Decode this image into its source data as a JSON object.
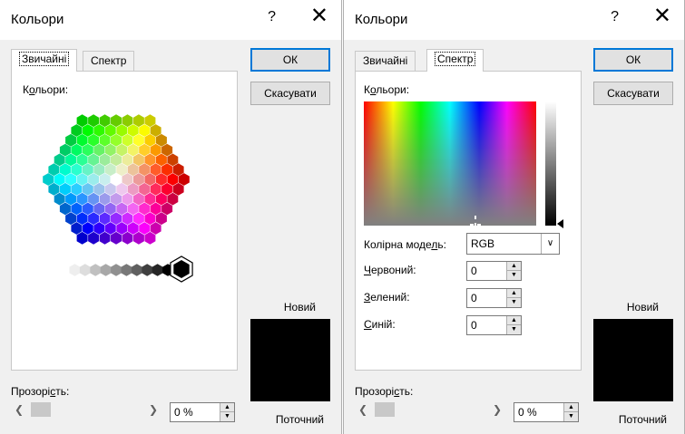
{
  "dialog": {
    "title": "Кольори",
    "help": "?",
    "close": "✕",
    "tabs": [
      "Звичайні",
      "Спектр"
    ],
    "ok": "ОК",
    "cancel": "Скасувати",
    "new_label": "Новий",
    "current_label": "Поточний",
    "current_color": "#000000",
    "transparency_prefix": "Прозорі",
    "transparency_mnemonic": "с",
    "transparency_suffix": "ть:",
    "transparency_value": "0 %"
  },
  "standard": {
    "colors_prefix": "К",
    "colors_mnemonic": "о",
    "colors_suffix": "льори:"
  },
  "spectrum": {
    "colors_prefix": "К",
    "colors_mnemonic": "о",
    "colors_suffix": "льори:",
    "model_prefix": "Колірна моде",
    "model_mnemonic": "л",
    "model_suffix": "ь:",
    "model_value": "RGB",
    "red_prefix": "",
    "red_mnemonic": "Ч",
    "red_suffix": "ервоний:",
    "red_value": "0",
    "green_prefix": "",
    "green_mnemonic": "З",
    "green_suffix": "елений:",
    "green_value": "0",
    "blue_prefix": "",
    "blue_mnemonic": "С",
    "blue_suffix": "иній:",
    "blue_value": "0"
  }
}
